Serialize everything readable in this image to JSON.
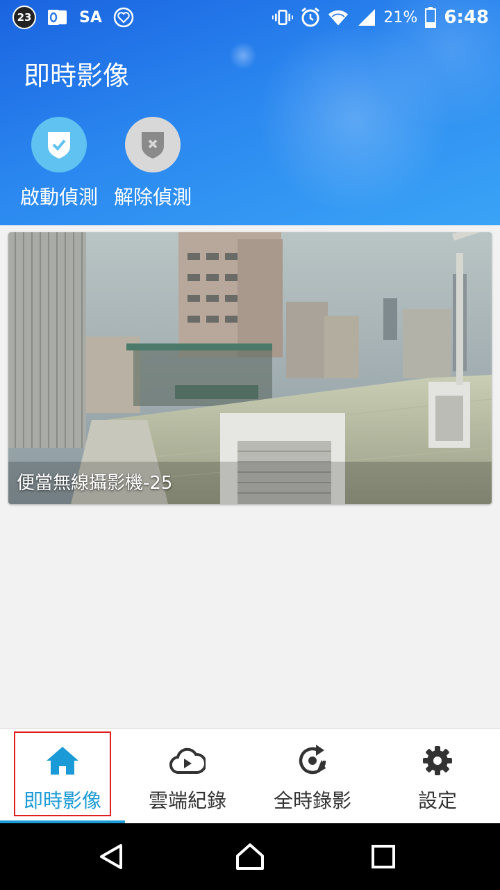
{
  "status_bar": {
    "notification_count": "23",
    "carrier_text": "SA",
    "battery_percent": "21%",
    "time": "6:48",
    "icons": [
      "outlook-icon",
      "heart-icon",
      "vibrate-icon",
      "alarm-icon",
      "wifi-icon",
      "signal-icon",
      "battery-icon"
    ]
  },
  "header": {
    "title": "即時影像",
    "actions": [
      {
        "label": "啟動偵測",
        "icon": "shield-check-icon",
        "color": "#5fc2f0"
      },
      {
        "label": "解除偵測",
        "icon": "shield-x-icon",
        "color": "#d8d8d8"
      }
    ]
  },
  "camera": {
    "name": "便當無線攝影機-25"
  },
  "bottom_nav": {
    "items": [
      {
        "label": "即時影像",
        "icon": "home-icon",
        "active": true
      },
      {
        "label": "雲端紀錄",
        "icon": "cloud-play-icon",
        "active": false
      },
      {
        "label": "全時錄影",
        "icon": "replay-icon",
        "active": false
      },
      {
        "label": "設定",
        "icon": "gear-icon",
        "active": false
      }
    ],
    "accent_color": "#1a9ad6"
  },
  "system_nav": {
    "buttons": [
      "back-icon",
      "home-circle-icon",
      "recents-icon"
    ]
  }
}
